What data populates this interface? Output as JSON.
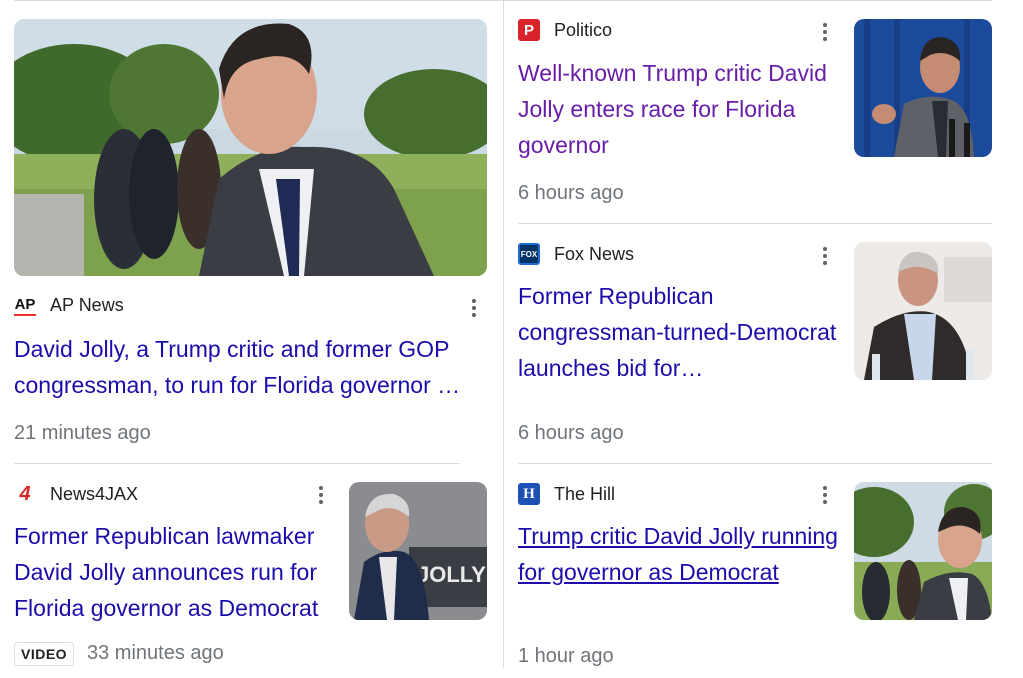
{
  "articles": [
    {
      "source": "AP News",
      "icon": "ap-news-logo-icon",
      "headline": "David Jolly, a Trump critic and former GOP congressman, to run for Florida governor …",
      "time": "21 minutes ago",
      "image": "photo-david-jolly-outdoors"
    },
    {
      "source": "News4JAX",
      "icon": "news4jax-logo-icon",
      "headline": "Former Republican lawmaker David Jolly announces run for Florida governor as Democrat",
      "time": "33 minutes ago",
      "badge": "VIDEO",
      "image": "photo-david-jolly-campaign-sign",
      "image_text": "JOLLY"
    },
    {
      "source": "Politico",
      "icon": "politico-logo-icon",
      "headline": "Well-known Trump critic David Jolly enters race for Florida governor",
      "time": "6 hours ago",
      "image": "photo-david-jolly-podium"
    },
    {
      "source": "Fox News",
      "icon": "fox-news-logo-icon",
      "headline": "Former Republican congressman-turned-Democrat launches bid for…",
      "time": "6 hours ago",
      "image": "photo-david-jolly-panel"
    },
    {
      "source": "The Hill",
      "icon": "the-hill-logo-icon",
      "headline": "Trump critic David Jolly running for governor as Democrat",
      "time": "1 hour ago",
      "image": "photo-david-jolly-outdoors-small"
    }
  ],
  "colors": {
    "link": "#1a0dab",
    "visited": "#681da8",
    "meta": "#70757a",
    "divider": "#dadce0"
  }
}
